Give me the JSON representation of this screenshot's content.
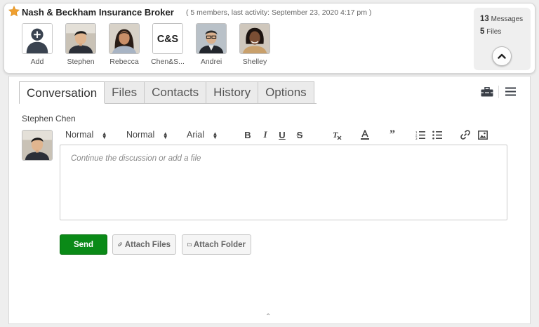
{
  "group": {
    "name": "Nash & Beckham Insurance Broker",
    "meta": "( 5 members, last activity: September 23, 2020 4:17 pm )"
  },
  "members": [
    {
      "name": "Add",
      "icon": "add-person-icon"
    },
    {
      "name": "Stephen"
    },
    {
      "name": "Rebecca"
    },
    {
      "name": "Chen&S..."
    },
    {
      "name": "Andrei"
    },
    {
      "name": "Shelley"
    }
  ],
  "logo_text": "C&S",
  "stats": {
    "messages_count": "13",
    "messages_label": "Messages",
    "files_count": "5",
    "files_label": "Files"
  },
  "tabs": [
    {
      "label": "Conversation",
      "active": true
    },
    {
      "label": "Files"
    },
    {
      "label": "Contacts"
    },
    {
      "label": "History"
    },
    {
      "label": "Options"
    }
  ],
  "composer": {
    "author": "Stephen Chen",
    "placeholder": "Continue the discussion or add a file",
    "toolbar": {
      "header_select": "Normal",
      "size_select": "Normal",
      "font_select": "Arial"
    },
    "send_label": "Send",
    "attach_files_label": "Attach Files",
    "attach_folder_label": "Attach Folder"
  },
  "colors": {
    "send": "#0a8a17",
    "star": "#f0a030"
  }
}
